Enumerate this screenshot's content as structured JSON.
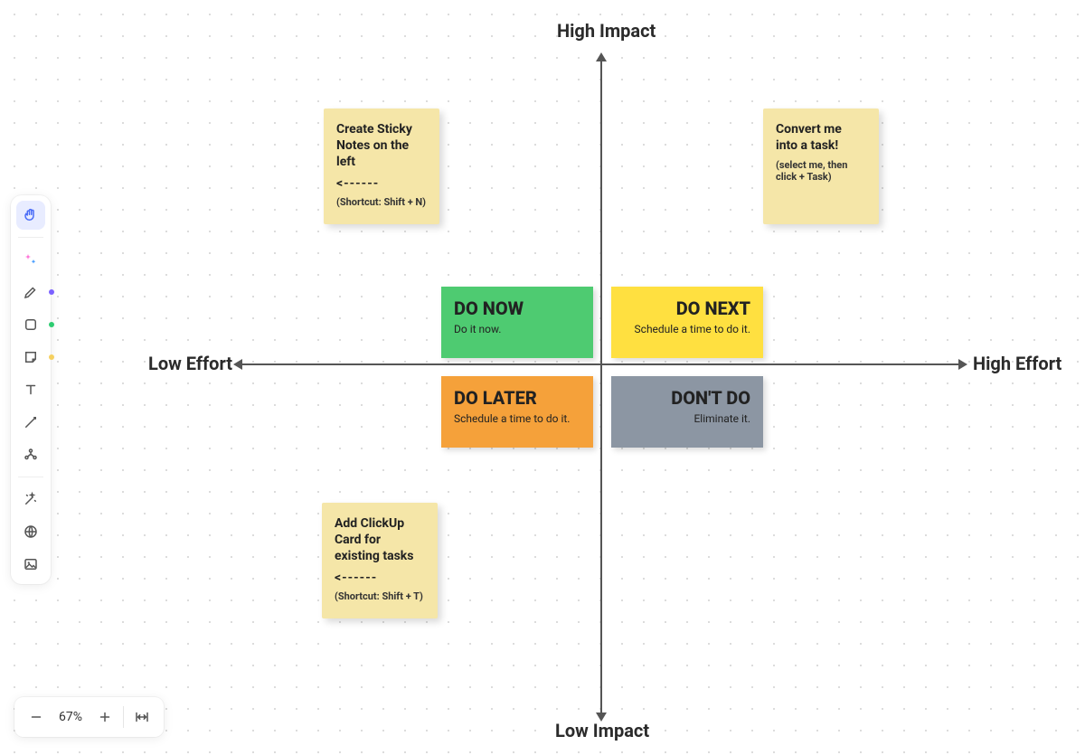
{
  "axes": {
    "top": "High Impact",
    "bottom": "Low Impact",
    "left": "Low Effort",
    "right": "High Effort"
  },
  "quadrants": {
    "do_now": {
      "title": "DO NOW",
      "subtitle": "Do it now."
    },
    "do_next": {
      "title": "DO NEXT",
      "subtitle": "Schedule a time to do it."
    },
    "do_later": {
      "title": "DO LATER",
      "subtitle": "Schedule a time to do it."
    },
    "dont_do": {
      "title": "DON'T DO",
      "subtitle": "Eliminate it."
    }
  },
  "stickies": {
    "create_notes": {
      "title": "Create Sticky Notes on the left",
      "arrow": "<------",
      "shortcut": "(Shortcut: Shift + N)"
    },
    "convert_task": {
      "title": "Convert me into a task!",
      "subtitle": "(select me, then click + Task)"
    },
    "add_card": {
      "title": "Add ClickUp Card for existing tasks",
      "arrow": "<------",
      "shortcut": "(Shortcut: Shift + T)"
    }
  },
  "zoom": {
    "value": "67%"
  },
  "colors": {
    "pen_dot": "#7b61ff",
    "shape_dot": "#2ecc71",
    "sticky_dot": "#f5d060"
  }
}
